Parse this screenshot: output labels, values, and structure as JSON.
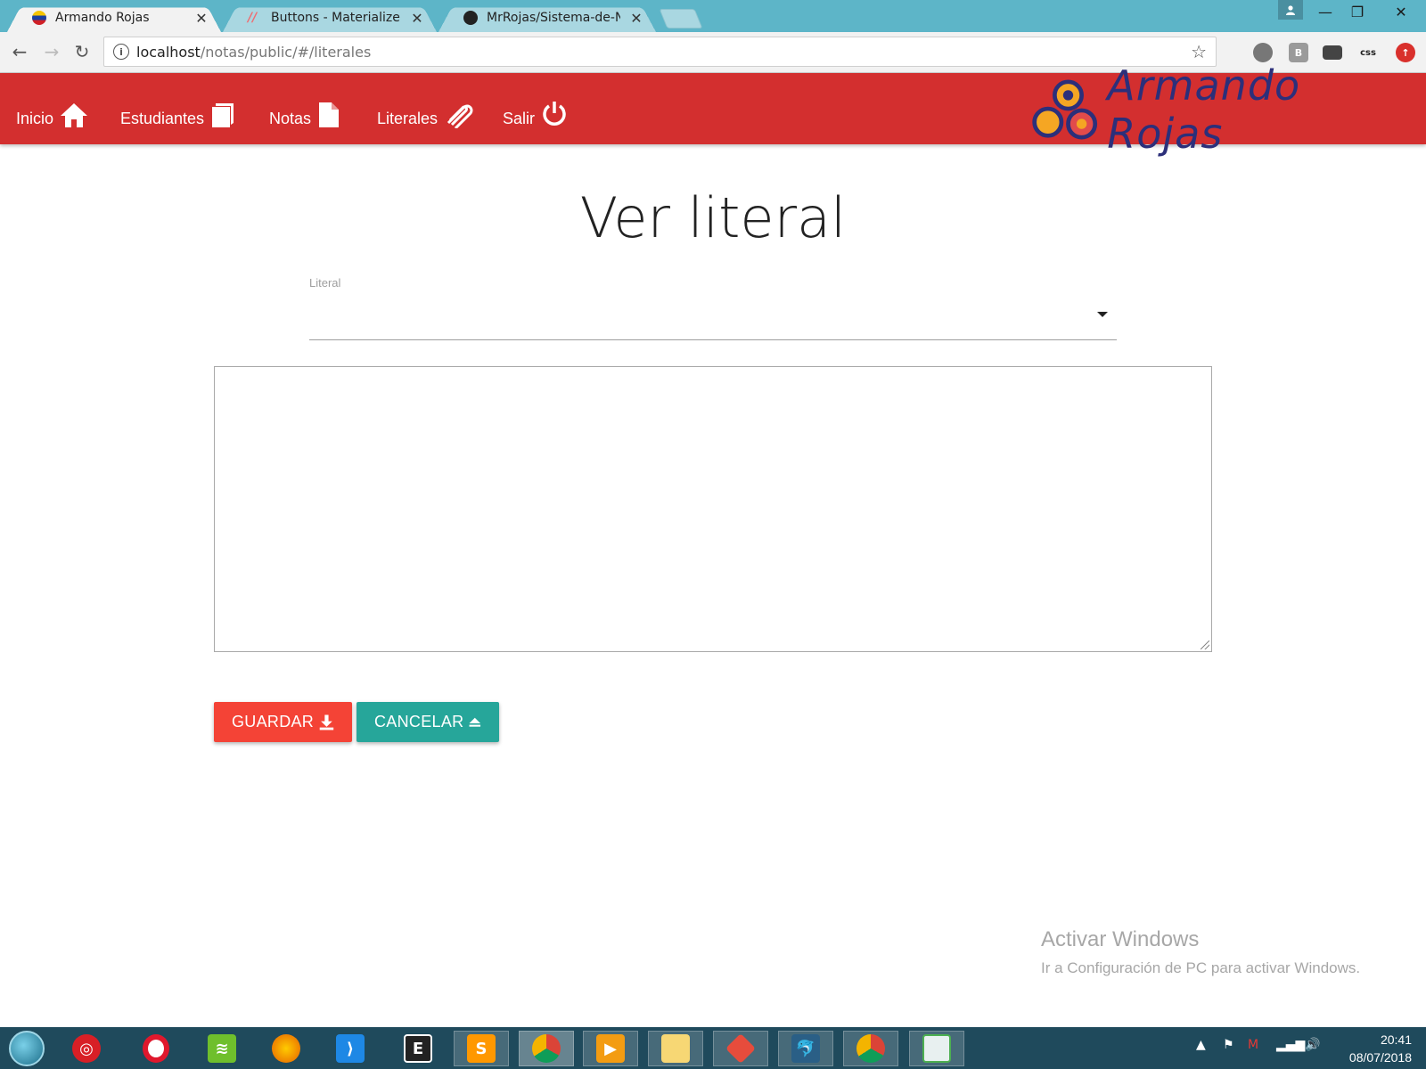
{
  "browser": {
    "tabs": [
      {
        "title": "Armando Rojas",
        "active": true
      },
      {
        "title": "Buttons - Materialize",
        "active": false
      },
      {
        "title": "MrRojas/Sistema-de-Not",
        "active": false
      }
    ],
    "url_host": "localhost",
    "url_path": "/notas/public/#/literales"
  },
  "navbar": {
    "items": [
      {
        "label": "Inicio",
        "icon": "home-icon"
      },
      {
        "label": "Estudiantes",
        "icon": "book-icon"
      },
      {
        "label": "Notas",
        "icon": "file-icon"
      },
      {
        "label": "Literales",
        "icon": "paperclip-icon"
      },
      {
        "label": "Salir",
        "icon": "power-icon"
      }
    ],
    "brand": "Armando Rojas",
    "color": "#d32f2f"
  },
  "main": {
    "title": "Ver literal",
    "select_label": "Literal",
    "select_value": "",
    "textarea_value": "",
    "save_label": "GUARDAR",
    "cancel_label": "CANCELAR",
    "save_color": "#f44336",
    "cancel_color": "#26a69a"
  },
  "watermark": {
    "title": "Activar Windows",
    "subtitle": "Ir a Configuración de PC para activar Windows."
  },
  "taskbar": {
    "time": "20:41",
    "date": "08/07/2018"
  }
}
